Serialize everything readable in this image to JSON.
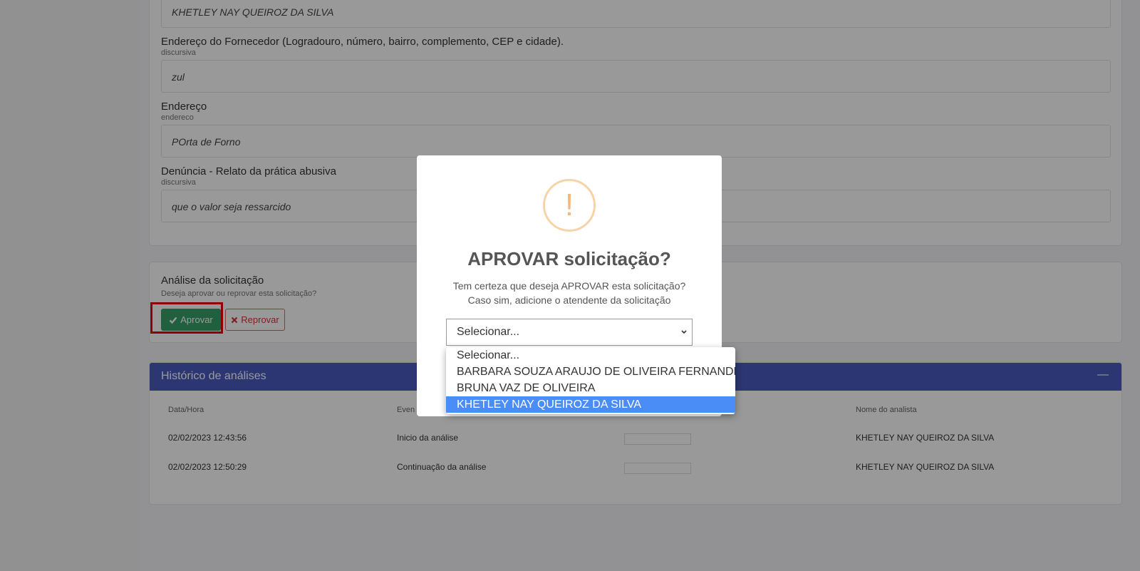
{
  "fields": [
    {
      "label": "",
      "sub": "",
      "value": "KHETLEY NAY QUEIROZ DA SILVA"
    },
    {
      "label": "Endereço do Fornecedor (Logradouro, número, bairro, complemento, CEP e cidade).",
      "sub": "discursiva",
      "value": "zul"
    },
    {
      "label": "Endereço",
      "sub": "endereco",
      "value": "POrta de Forno"
    },
    {
      "label": "Denúncia - Relato da prática abusiva",
      "sub": "discursiva",
      "value": "que o valor seja ressarcido"
    }
  ],
  "analysis": {
    "title": "Análise da solicitação",
    "subtitle": "Deseja aprovar ou reprovar esta solicitação?",
    "approve_label": "Aprovar",
    "reject_label": "Reprovar",
    "approve_icon": "check-icon",
    "reject_icon": "x-icon"
  },
  "history": {
    "title": "Histórico de análises",
    "collapse_symbol": "—",
    "columns": [
      "Data/Hora",
      "Even",
      "",
      "Nome do analista"
    ],
    "rows": [
      {
        "datetime": "02/02/2023 12:43:56",
        "event": "Inicio da análise",
        "analyst": "KHETLEY NAY QUEIROZ DA SILVA"
      },
      {
        "datetime": "02/02/2023 12:50:29",
        "event": "Continuação da análise",
        "analyst": "KHETLEY NAY QUEIROZ DA SILVA"
      }
    ]
  },
  "modal": {
    "icon": "!",
    "title": "APROVAR solicitação?",
    "text_line1": "Tem certeza que deseja APROVAR esta solicitação?",
    "text_line2": "Caso sim, adicione o atendente da solicitação",
    "select_value": "Selecionar...",
    "options": [
      "Selecionar...",
      "BARBARA SOUZA ARAUJO DE OLIVEIRA FERNANDES",
      "BRUNA VAZ DE OLIVEIRA",
      "KHETLEY NAY QUEIROZ DA SILVA"
    ],
    "highlighted_option": "KHETLEY NAY QUEIROZ DA SILVA"
  },
  "colors": {
    "approve": "#38a169",
    "reject": "#dd3333",
    "history_header": "#4a5bbf",
    "highlight": "#4a8df7",
    "warning": "#f5b77a"
  }
}
